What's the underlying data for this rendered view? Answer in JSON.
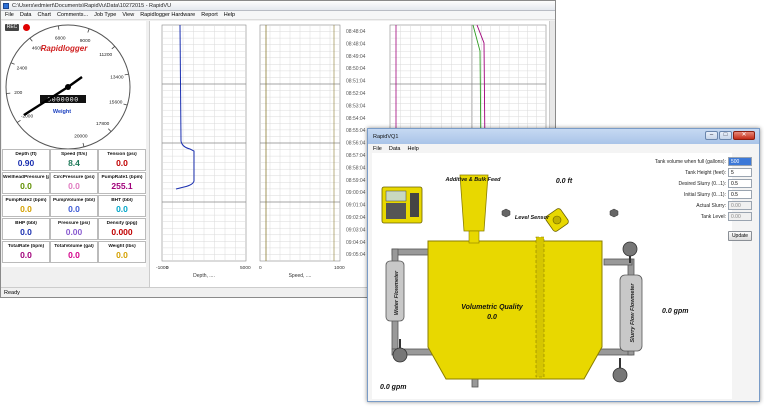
{
  "main_window": {
    "title": "C:\\Users\\edmiert\\Documents\\RapidVu\\Data\\10272015 - RapidVU",
    "menu": [
      "File",
      "Data",
      "Chart",
      "Comments...",
      "Job Type",
      "View",
      "Rapidlogger Hardware",
      "Report",
      "Help"
    ],
    "rec_label": "REC",
    "status": "Ready"
  },
  "dial": {
    "brand": "Rapidlogger",
    "unit": "Weight",
    "odometer": "0000000",
    "ticks": [
      "-2000",
      "200",
      "2400",
      "4600",
      "6800",
      "9000",
      "11200",
      "13400",
      "15600",
      "17800",
      "20000"
    ]
  },
  "readings": [
    {
      "label": "Depth (ft)",
      "value": "0.90",
      "color": "#1a2fb0"
    },
    {
      "label": "Speed (ft/s)",
      "value": "8.4",
      "color": "#1f7a5a"
    },
    {
      "label": "Tension (psi)",
      "value": "0.0",
      "color": "#c00000"
    },
    {
      "label": "WellheadPressure (psi)",
      "value": "0.0",
      "color": "#5f8f00"
    },
    {
      "label": "CircPressure (psi)",
      "value": "0.0",
      "color": "#e07ac0"
    },
    {
      "label": "PumpRate1 (bpm)",
      "value": "255.1",
      "color": "#a0007a"
    },
    {
      "label": "PumpRate2 (bpm)",
      "value": "0.0",
      "color": "#d4a000"
    },
    {
      "label": "PumpVolume (bbl)",
      "value": "0.0",
      "color": "#3e5bd6"
    },
    {
      "label": "BHT (bbl)",
      "value": "0.0",
      "color": "#00a6c8"
    },
    {
      "label": "BHP (bbl)",
      "value": "0.0",
      "color": "#1a2fb0"
    },
    {
      "label": "Pressure (psi)",
      "value": "0.00",
      "color": "#8a5cd0"
    },
    {
      "label": "Density (ppg)",
      "value": "0.000",
      "color": "#c00000"
    },
    {
      "label": "TotalRate (bpm)",
      "value": "0.0",
      "color": "#a0007a"
    },
    {
      "label": "TotalVolume (gal)",
      "value": "0.0",
      "color": "#d4008a"
    },
    {
      "label": "Weight (lbs)",
      "value": "0.0",
      "color": "#d4a000"
    }
  ],
  "chart_data": {
    "type": "line",
    "times": [
      "08:48:04",
      "08:48:04",
      "08:49:04",
      "08:50:04",
      "08:51:04",
      "08:52:04",
      "08:53:04",
      "08:54:04",
      "08:55:04",
      "08:56:04",
      "08:57:04",
      "08:58:04",
      "08:59:04",
      "09:00:04",
      "09:01:04",
      "09:02:04",
      "09:03:04",
      "09:04:04",
      "09:05:04"
    ],
    "tracks": [
      {
        "xlabel": "Depth, ....",
        "ticks": [
          "-1000",
          "0",
          "5000"
        ],
        "color": "#1a2fb0"
      },
      {
        "xlabel": "Speed, ....",
        "ticks": [
          "0",
          "1000"
        ],
        "color": "#8a7a30"
      }
    ]
  },
  "vq_window": {
    "title": "RapidVQ1",
    "menu": [
      "File",
      "Data",
      "Help"
    ],
    "fields": [
      {
        "label": "Tank volume when full (gallons):",
        "value": "500",
        "state": "selected"
      },
      {
        "label": "Tank Height (feet):",
        "value": "5",
        "state": "normal"
      },
      {
        "label": "Desired Slurry (0...1):",
        "value": "0.5",
        "state": "normal"
      },
      {
        "label": "Initial Slurry (0...1):",
        "value": "0.5",
        "state": "normal"
      },
      {
        "label": "Actual Slurry:",
        "value": "0.00",
        "state": "readonly"
      },
      {
        "label": "Tank Level:",
        "value": "0.00",
        "state": "readonly"
      }
    ],
    "update_label": "Update",
    "additive_label": "Additive & Bulk Feed",
    "level_value": "0.0 ft",
    "level_sensor": "Level Sensor",
    "vq_label": "Volumetric Quality",
    "vq_value": "0.0",
    "water_flowmeter": "Water Flowmeter",
    "slurry_flowmeter": "Slurry Flow Flowmeter",
    "slurry_rate": "0.0 gpm",
    "water_rate": "0.0 gpm"
  }
}
